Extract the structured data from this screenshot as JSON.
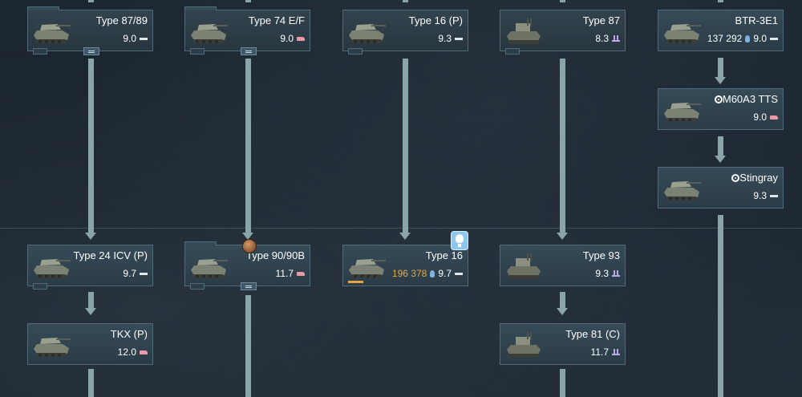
{
  "tree": {
    "cards": [
      {
        "id": "type-87-89",
        "name": "Type 87/89",
        "br": "9.0",
        "role": "ground",
        "rp": "",
        "researched": true
      },
      {
        "id": "type-74-ef",
        "name": "Type 74 E/F",
        "br": "9.0",
        "role": "tank",
        "rp": "",
        "researched": true
      },
      {
        "id": "type-16-p",
        "name": "Type 16 (P)",
        "br": "9.3",
        "role": "ground",
        "rp": "",
        "researched": true
      },
      {
        "id": "type-87",
        "name": "Type 87",
        "br": "8.3",
        "role": "spaa",
        "rp": "",
        "researched": true
      },
      {
        "id": "btr-3e1",
        "name": "BTR-3E1",
        "br": "9.0",
        "role": "ground",
        "rp": "137 292",
        "researched": false
      },
      {
        "id": "m60a3-tts",
        "name": "M60A3 TTS",
        "br": "9.0",
        "role": "tank",
        "rp": "",
        "researched": false
      },
      {
        "id": "stingray",
        "name": "Stingray",
        "br": "9.3",
        "role": "ground",
        "rp": "",
        "researched": false
      },
      {
        "id": "type-24-icv-p",
        "name": "Type 24 ICV (P)",
        "br": "9.7",
        "role": "ground",
        "rp": "",
        "researched": false
      },
      {
        "id": "type-90-90b",
        "name": "Type 90/90B",
        "br": "11.7",
        "role": "tank",
        "rp": "",
        "researched": false
      },
      {
        "id": "type-16",
        "name": "Type 16",
        "br": "9.7",
        "role": "ground",
        "rp": "196 378",
        "researched": false,
        "progress": 0.13
      },
      {
        "id": "type-93",
        "name": "Type 93",
        "br": "9.3",
        "role": "spaa",
        "rp": "",
        "researched": false
      },
      {
        "id": "tkx-p",
        "name": "TKX (P)",
        "br": "12.0",
        "role": "tank",
        "rp": "",
        "researched": false
      },
      {
        "id": "type-81-c",
        "name": "Type 81 (C)",
        "br": "11.7",
        "role": "spaa",
        "rp": "",
        "researched": false
      }
    ]
  },
  "icons": {
    "ground_role": "light-vehicle-role-icon",
    "tank_role": "tank-role-icon",
    "spaa_role": "spaa-role-icon",
    "rp": "research-bulb-icon"
  },
  "colors": {
    "rp_text": "#e6a645",
    "connector": "#8aa5a8",
    "research_marker": "#8ec7ee"
  }
}
